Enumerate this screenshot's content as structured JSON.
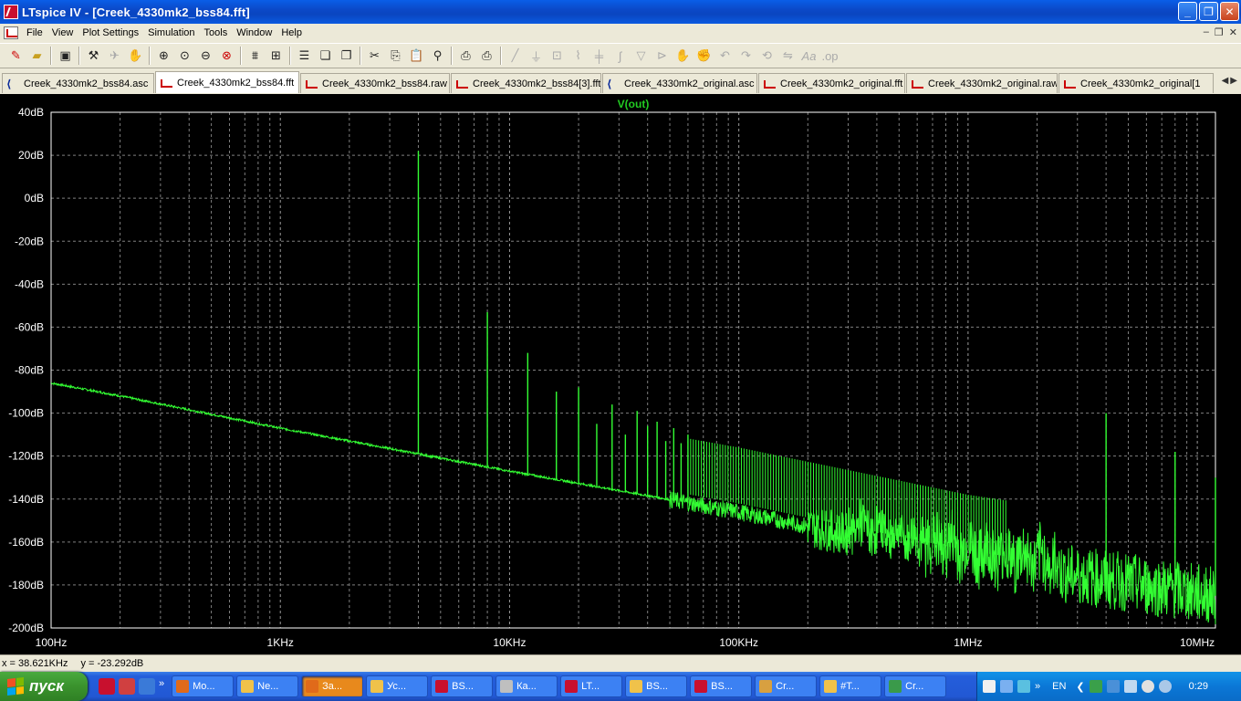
{
  "window": {
    "title": "LTspice IV - [Creek_4330mk2_bss84.fft]"
  },
  "menu": [
    "File",
    "View",
    "Plot Settings",
    "Simulation",
    "Tools",
    "Window",
    "Help"
  ],
  "toolbar_icons": [
    "new-schematic-icon",
    "open-icon",
    "save-icon",
    "hammer-icon",
    "run-icon",
    "halt-icon",
    "zoom-in-icon",
    "zoom-pan-icon",
    "zoom-out-icon",
    "zoom-cancel-icon",
    "autorange-icon",
    "markers-icon",
    "tile-horizontal-icon",
    "cascade-icon",
    "tile-vertical-icon",
    "cut-icon",
    "copy-icon",
    "paste-icon",
    "find-icon",
    "print-setup-icon",
    "print-icon",
    "wire-icon",
    "ground-icon",
    "label-icon",
    "resistor-icon",
    "capacitor-icon",
    "inductor-icon",
    "diode-icon",
    "component-icon",
    "move-icon",
    "drag-icon",
    "undo-icon",
    "redo-icon",
    "rotate-icon",
    "mirror-icon",
    "text-icon",
    "spice-directive-icon"
  ],
  "tabs": [
    {
      "label": "Creek_4330mk2_bss84.asc",
      "icon": "schematic",
      "active": false
    },
    {
      "label": "Creek_4330mk2_bss84.fft",
      "icon": "waveform",
      "active": true
    },
    {
      "label": "Creek_4330mk2_bss84.raw",
      "icon": "waveform",
      "active": false
    },
    {
      "label": "Creek_4330mk2_bss84[3].fft",
      "icon": "waveform",
      "active": false
    },
    {
      "label": "Creek_4330mk2_original.asc",
      "icon": "schematic",
      "active": false
    },
    {
      "label": "Creek_4330mk2_original.fft",
      "icon": "waveform",
      "active": false
    },
    {
      "label": "Creek_4330mk2_original.raw",
      "icon": "waveform",
      "active": false
    },
    {
      "label": "Creek_4330mk2_original[1",
      "icon": "waveform",
      "active": false
    }
  ],
  "chart_data": {
    "type": "line",
    "title": "V(out)",
    "xscale": "log",
    "xlim": [
      100,
      12000000
    ],
    "ylim": [
      -200,
      40
    ],
    "y_ticks": [
      "40dB",
      "20dB",
      "0dB",
      "-20dB",
      "-40dB",
      "-60dB",
      "-80dB",
      "-100dB",
      "-120dB",
      "-140dB",
      "-160dB",
      "-180dB",
      "-200dB"
    ],
    "x_ticks": [
      "100Hz",
      "1KHz",
      "10KHz",
      "100KHz",
      "1MHz",
      "10MHz"
    ],
    "grid": true,
    "colors": {
      "background": "#000000",
      "trace": "#33ff33",
      "grid": "#7f7f7f",
      "title": "#22cc22"
    },
    "series": [
      {
        "name": "V(out)",
        "noise_floor": {
          "x": [
            100,
            200,
            1000,
            4000,
            10000,
            100000,
            1000000,
            12000000
          ],
          "y": [
            -86,
            -92,
            -107,
            -119,
            -127,
            -146,
            -168,
            -185
          ]
        },
        "harmonics": [
          {
            "f": 4000,
            "db": 22
          },
          {
            "f": 8000,
            "db": -53
          },
          {
            "f": 12000,
            "db": -72
          },
          {
            "f": 16000,
            "db": -90
          },
          {
            "f": 20000,
            "db": -88
          },
          {
            "f": 24000,
            "db": -105
          },
          {
            "f": 28000,
            "db": -96
          },
          {
            "f": 32000,
            "db": -110
          },
          {
            "f": 36000,
            "db": -99
          },
          {
            "f": 40000,
            "db": -106
          },
          {
            "f": 44000,
            "db": -104
          },
          {
            "f": 48000,
            "db": -113
          },
          {
            "f": 52000,
            "db": -107
          },
          {
            "f": 56000,
            "db": -114
          },
          {
            "f": 60000,
            "db": -110
          },
          {
            "f": 4000000,
            "db": -100
          },
          {
            "f": 8000000,
            "db": -118
          },
          {
            "f": 12000000,
            "db": -130
          }
        ]
      }
    ]
  },
  "status": {
    "x_readout": "x = 38.621KHz",
    "y_readout": "y = -23.292dB"
  },
  "taskbar": {
    "start_label": "пуск",
    "tasks": [
      {
        "label": "Mo...",
        "color": "#e06a1a"
      },
      {
        "label": "Ne...",
        "color": "#f0c24a"
      },
      {
        "label": "За...",
        "color": "#e06a1a",
        "active": true
      },
      {
        "label": "Ус...",
        "color": "#f0c24a"
      },
      {
        "label": "BS...",
        "color": "#c8102e"
      },
      {
        "label": "Ка...",
        "color": "#bfbfbf"
      },
      {
        "label": "LT...",
        "color": "#c8102e"
      },
      {
        "label": "BS...",
        "color": "#f0c24a"
      },
      {
        "label": "BS...",
        "color": "#c8102e"
      },
      {
        "label": "Cr...",
        "color": "#d8a040"
      },
      {
        "label": "#T...",
        "color": "#f0c24a"
      },
      {
        "label": "Cr...",
        "color": "#3a9a4a"
      }
    ],
    "lang": "EN",
    "clock": "0:29"
  }
}
